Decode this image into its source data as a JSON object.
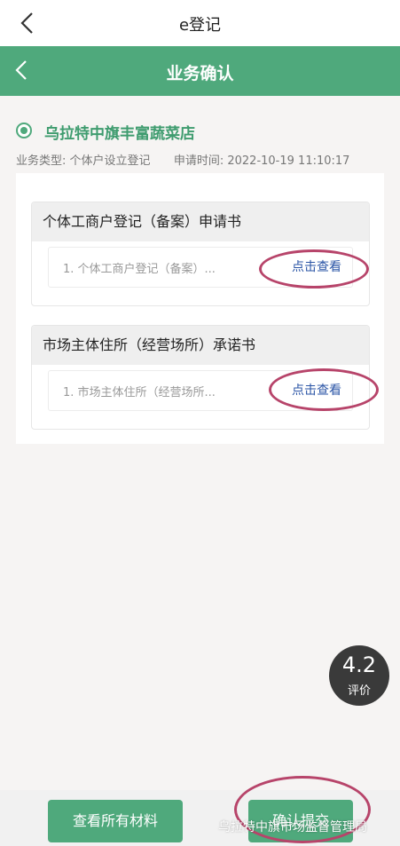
{
  "nav": {
    "title": "e登记"
  },
  "header": {
    "title": "业务确认"
  },
  "business": {
    "shop_name": "乌拉特中旗丰富蔬菜店",
    "type_label": "业务类型:",
    "type_value": "个体户设立登记",
    "time_label": "申请时间:",
    "time_value": "2022-10-19 11:10:17"
  },
  "documents": [
    {
      "title": "个体工商户登记（备案）申请书",
      "item": "1. 个体工商户登记（备案）...",
      "action": "点击查看"
    },
    {
      "title": "市场主体住所（经营场所）承诺书",
      "item": "1. 市场主体住所（经营场所...",
      "action": "点击查看"
    }
  ],
  "rating": {
    "score": "4.2",
    "label": "评价"
  },
  "footer": {
    "view_all_label": "查看所有材料",
    "confirm_label": "确认提交",
    "watermark": "乌拉特中旗市场监督管理局"
  },
  "colors": {
    "primary_green": "#4fa97c",
    "link_blue": "#2b55a6",
    "annotation_magenta": "#b7446a"
  }
}
